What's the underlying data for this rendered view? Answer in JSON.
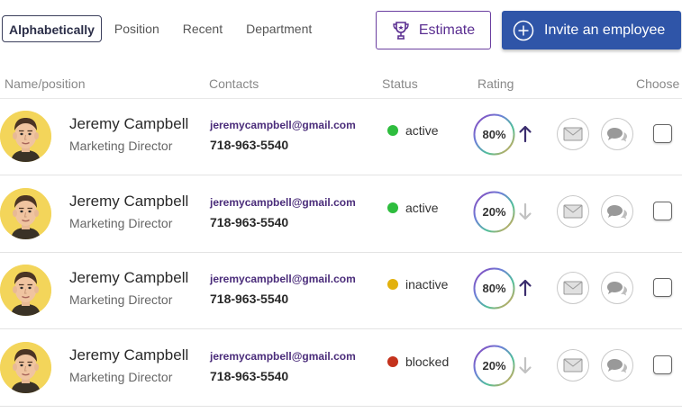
{
  "sort_tabs": [
    {
      "label": "Alphabetically",
      "active": true
    },
    {
      "label": "Position",
      "active": false
    },
    {
      "label": "Recent",
      "active": false
    },
    {
      "label": "Department",
      "active": false
    }
  ],
  "buttons": {
    "estimate_label": "Estimate",
    "invite_label": "Invite an employee"
  },
  "columns": {
    "name": "Name/position",
    "contacts": "Contacts",
    "status": "Status",
    "rating": "Rating",
    "choose": "Choose"
  },
  "colors": {
    "active": "#2ebd3e",
    "inactive": "#e2b10d",
    "blocked": "#c4321c",
    "trend_up": "#3b2d6e",
    "trend_down": "#c2c2c2",
    "primary": "#2f55a8",
    "estimate": "#5a2e91"
  },
  "employees": [
    {
      "name": "Jeremy Campbell",
      "position": "Marketing Director",
      "email": "jeremycampbell@gmail.com",
      "phone": "718-963-5540",
      "status": "active",
      "rating": "80%",
      "trend": "up"
    },
    {
      "name": "Jeremy Campbell",
      "position": "Marketing Director",
      "email": "jeremycampbell@gmail.com",
      "phone": "718-963-5540",
      "status": "active",
      "rating": "20%",
      "trend": "down"
    },
    {
      "name": "Jeremy Campbell",
      "position": "Marketing Director",
      "email": "jeremycampbell@gmail.com",
      "phone": "718-963-5540",
      "status": "inactive",
      "rating": "80%",
      "trend": "up"
    },
    {
      "name": "Jeremy Campbell",
      "position": "Marketing Director",
      "email": "jeremycampbell@gmail.com",
      "phone": "718-963-5540",
      "status": "blocked",
      "rating": "20%",
      "trend": "down"
    }
  ]
}
